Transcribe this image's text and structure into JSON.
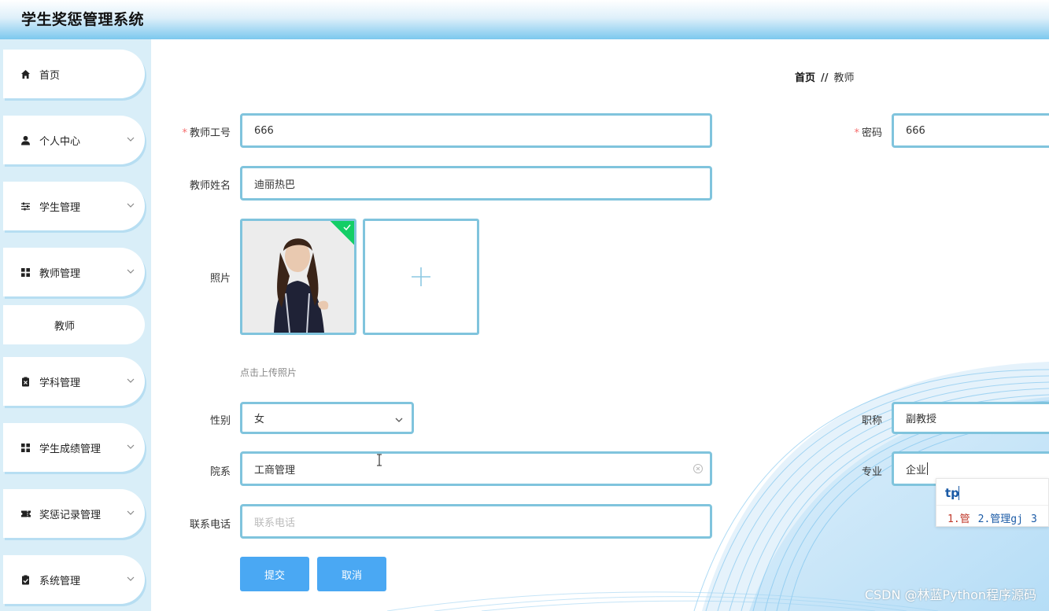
{
  "app": {
    "title": "学生奖惩管理系统"
  },
  "sidebar": {
    "items": [
      {
        "label": "首页",
        "icon": "home-icon"
      },
      {
        "label": "个人中心",
        "icon": "user-icon"
      },
      {
        "label": "学生管理",
        "icon": "sliders-icon"
      },
      {
        "label": "教师管理",
        "icon": "grid-icon"
      },
      {
        "label": "学科管理",
        "icon": "clipboard-x-icon"
      },
      {
        "label": "学生成绩管理",
        "icon": "grid-icon"
      },
      {
        "label": "奖惩记录管理",
        "icon": "ticket-icon"
      },
      {
        "label": "系统管理",
        "icon": "clipboard-check-icon"
      }
    ],
    "submenu": {
      "label": "教师"
    }
  },
  "breadcrumb": {
    "home": "首页",
    "separator": "//",
    "current": "教师"
  },
  "form": {
    "teacher_id": {
      "label": "教师工号",
      "value": "666",
      "required": true
    },
    "password": {
      "label": "密码",
      "value": "666",
      "required": true
    },
    "teacher_name": {
      "label": "教师姓名",
      "value": "迪丽热巴"
    },
    "photo": {
      "label": "照片",
      "hint": "点击上传照片"
    },
    "gender": {
      "label": "性别",
      "value": "女"
    },
    "title": {
      "label": "职称",
      "value": "副教授"
    },
    "department": {
      "label": "院系",
      "value": "工商管理"
    },
    "major": {
      "label": "专业",
      "value": "企业"
    },
    "phone": {
      "label": "联系电话",
      "placeholder": "联系电话"
    },
    "required_mark": "*"
  },
  "buttons": {
    "submit": "提交",
    "cancel": "取消"
  },
  "ime": {
    "composition": "tp",
    "candidates": [
      "1.管",
      "2.管理gj",
      "3"
    ]
  },
  "watermark": "CSDN @林蓝Python程序源码",
  "colors": {
    "accent": "#4aa8f3",
    "field_border": "#80c4dd",
    "success": "#13ce66",
    "required": "#f56c6c",
    "sidebar_bg": "#d9eef8"
  }
}
